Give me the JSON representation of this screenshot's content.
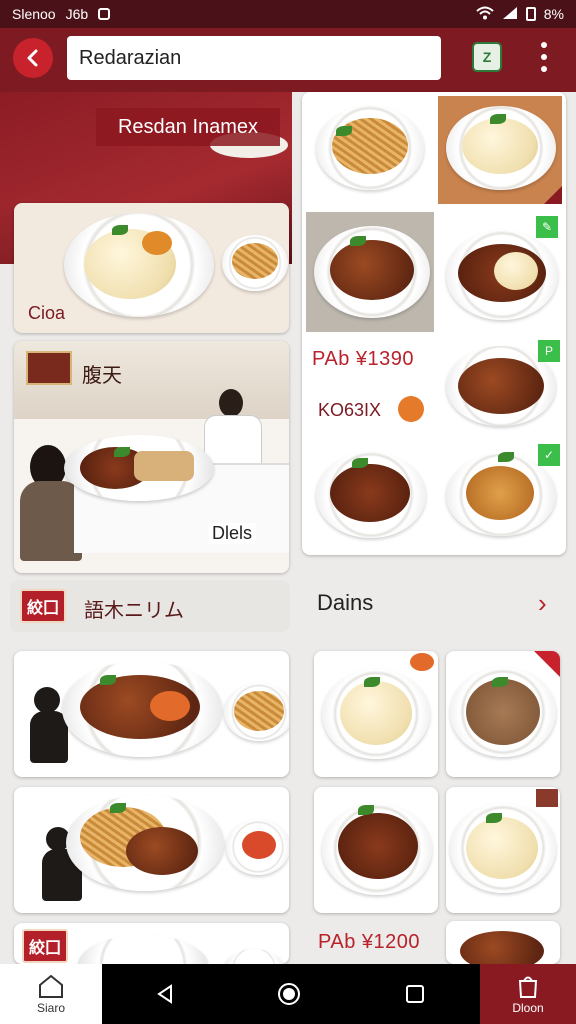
{
  "status_bar": {
    "left_text": "Slenoo",
    "left_extra": "J6b",
    "battery": "8%"
  },
  "app_bar": {
    "back_icon": "arrow-left-icon",
    "search_value": "Redarazian",
    "app_icon_label": "Z"
  },
  "hero": {
    "title": "Resdan Inamex"
  },
  "left_column": {
    "featured_label": "Cioa",
    "restaurant_card_caption": "腹天",
    "restaurant_scene_label": "Dlels",
    "tag_section": {
      "badge": "絞囗",
      "title": "語木ニリム"
    },
    "bottom_badge": "絞囗"
  },
  "right_column": {
    "price_1": "PAb ¥1390",
    "item_code": "KO63IX",
    "corner_tag": "P",
    "section_title": "Dains",
    "section_arrow": "›",
    "price_2": "PAb ¥1200"
  },
  "nav": {
    "home_label": "Siaro",
    "order_label": "Dloon"
  },
  "colors": {
    "primary": "#7d1a22",
    "accent": "#c8232c",
    "price": "#b8222b"
  }
}
